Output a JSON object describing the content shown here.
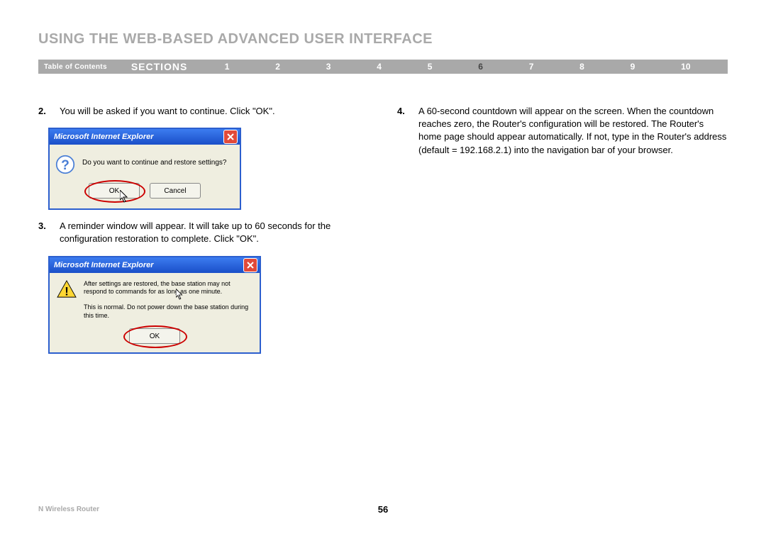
{
  "title": "USING THE WEB-BASED ADVANCED USER INTERFACE",
  "nav": {
    "toc": "Table of Contents",
    "sections_label": "SECTIONS",
    "items": [
      "1",
      "2",
      "3",
      "4",
      "5",
      "6",
      "7",
      "8",
      "9",
      "10"
    ],
    "active_index": 5
  },
  "steps": {
    "s2": {
      "num": "2.",
      "text": "You will be asked if you want to continue. Click \"OK\"."
    },
    "s3": {
      "num": "3.",
      "text": "A reminder window will appear. It will take up to 60 seconds for the configuration restoration to complete. Click \"OK\"."
    },
    "s4": {
      "num": "4.",
      "text": "A 60-second countdown will appear on the screen. When the countdown reaches zero, the Router's configuration will be restored. The Router's home page should appear automatically. If not, type in the Router's address (default = 192.168.2.1) into the navigation bar of your browser."
    }
  },
  "dialog1": {
    "title": "Microsoft Internet Explorer",
    "message": "Do you want to continue and restore settings?",
    "ok": "OK",
    "cancel": "Cancel"
  },
  "dialog2": {
    "title": "Microsoft Internet Explorer",
    "line1": "After settings are restored, the base station may not respond to commands for as long as one minute.",
    "line2": "This is normal. Do not power down the base station during this time.",
    "ok": "OK"
  },
  "footer": {
    "product": "N Wireless Router",
    "page": "56"
  }
}
